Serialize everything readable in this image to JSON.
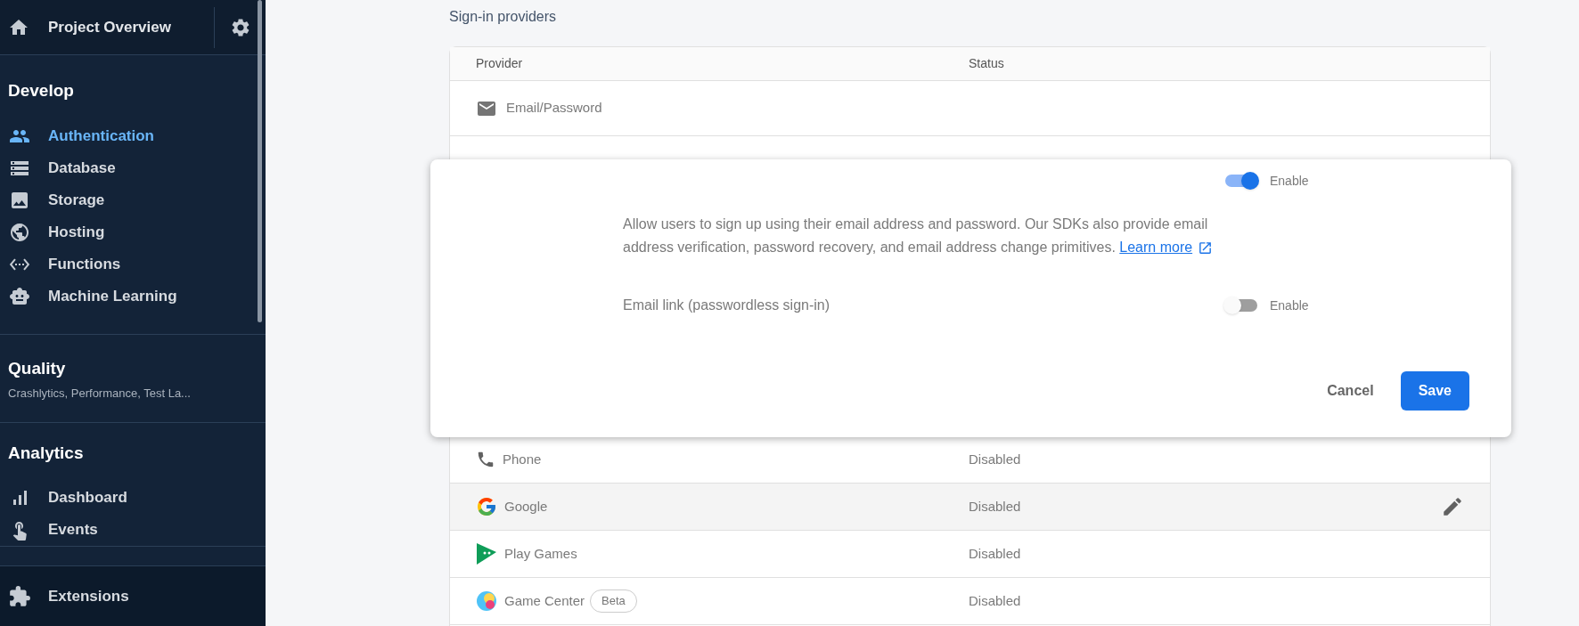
{
  "sidebar": {
    "header": {
      "title": "Project Overview"
    },
    "sections": [
      {
        "title": "Develop",
        "items": [
          {
            "label": "Authentication",
            "selected": true
          },
          {
            "label": "Database",
            "selected": false
          },
          {
            "label": "Storage",
            "selected": false
          },
          {
            "label": "Hosting",
            "selected": false
          },
          {
            "label": "Functions",
            "selected": false
          },
          {
            "label": "Machine Learning",
            "selected": false
          }
        ]
      },
      {
        "title": "Quality",
        "subtitle": "Crashlytics, Performance, Test La..."
      },
      {
        "title": "Analytics",
        "items": [
          {
            "label": "Dashboard",
            "selected": false
          },
          {
            "label": "Events",
            "selected": false
          }
        ]
      }
    ],
    "footer": {
      "label": "Extensions"
    }
  },
  "main": {
    "heading": "Sign-in providers",
    "table": {
      "columns": [
        "Provider",
        "Status"
      ],
      "expanded_row": {
        "name": "Email/Password"
      },
      "rows": [
        {
          "name": "Phone",
          "status": "Disabled",
          "selected": false
        },
        {
          "name": "Google",
          "status": "Disabled",
          "selected": true
        },
        {
          "name": "Play Games",
          "status": "Disabled",
          "selected": false
        },
        {
          "name": "Game Center",
          "badge": "Beta",
          "status": "Disabled",
          "selected": false
        }
      ]
    },
    "dialog": {
      "enable_toggle": {
        "label": "Enable",
        "on": true
      },
      "description": "Allow users to sign up using their email address and password. Our SDKs also provide email address verification, password recovery, and email address change primitives.",
      "link": "Learn more",
      "email_link": {
        "label": "Email link (passwordless sign-in)",
        "toggle_label": "Enable",
        "on": false
      },
      "buttons": [
        "Cancel",
        "Save"
      ]
    }
  }
}
